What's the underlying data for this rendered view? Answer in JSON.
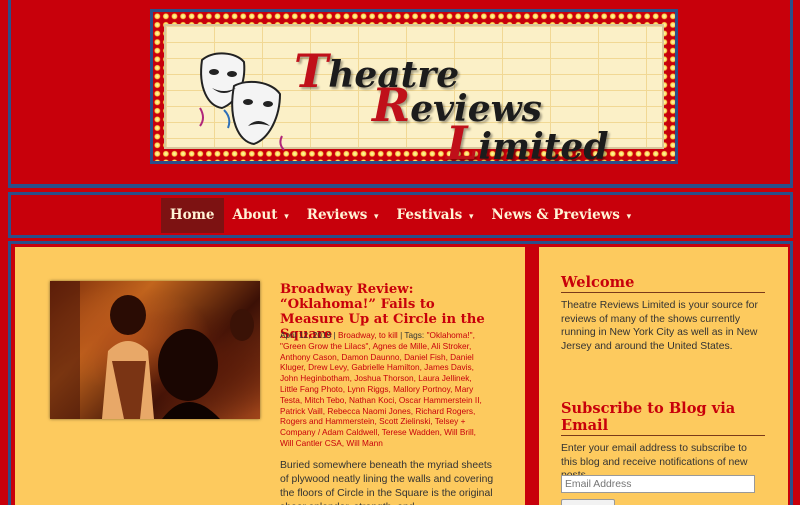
{
  "site": {
    "logo_line1_cap": "T",
    "logo_line1_rest": "heatre",
    "logo_line2_cap": "R",
    "logo_line2_rest": "eviews",
    "logo_line3_cap": "L",
    "logo_line3_rest": "imited"
  },
  "nav": {
    "items": [
      {
        "label": "Home",
        "active": true
      },
      {
        "label": "About",
        "caret": "▾"
      },
      {
        "label": "Reviews",
        "caret": "▾"
      },
      {
        "label": "Festivals",
        "caret": "▾"
      },
      {
        "label": "News & Previews",
        "caret": "▾"
      }
    ]
  },
  "post": {
    "title": "Broadway Review: “Oklahoma!” Fails to Measure Up at Circle in the Square",
    "date": "April 12, 2019",
    "categories": "Broadway, to kill",
    "tags_label": "Tags:",
    "tags": "\"Oklahoma!\", \"Green Grow the Lilacs\", Agnes de Mille, Ali Stroker, Anthony Cason, Damon Daunno, Daniel Fish, Daniel Kluger, Drew Levy, Gabrielle Hamilton, James Davis, John Heginbotham, Joshua Thorson, Laura Jellinek, Little Fang Photo, Lynn Riggs, Mallory Portnoy, Mary Testa, Mitch Tebo, Nathan Koci, Oscar Hammerstein II, Patrick Vaill, Rebecca Naomi Jones, Richard Rogers, Rogers and Hammerstein, Scott Zielinski, Telsey + Company / Adam Caldwell, Terese Wadden, Will Brill, Will Cantler CSA, Will Mann",
    "excerpt": "Buried somewhere beneath the myriad sheets of plywood neatly lining the walls and covering the floors of Circle in the Square is the original sheer splendor, strength, and"
  },
  "sidebar": {
    "welcome_title": "Welcome",
    "welcome_text": "Theatre Reviews Limited is your source for reviews of many of the shows currently running in New York City as well as in New Jersey and around the United States.",
    "subscribe_title": "Subscribe to Blog via Email",
    "subscribe_text": "Enter your email address to subscribe to this blog and receive notifications of new posts.",
    "email_placeholder": "Email Address"
  },
  "colors": {
    "brand_red": "#c8000b",
    "panel_yellow": "#fdca5e",
    "frame_blue": "#2b4f8a"
  }
}
